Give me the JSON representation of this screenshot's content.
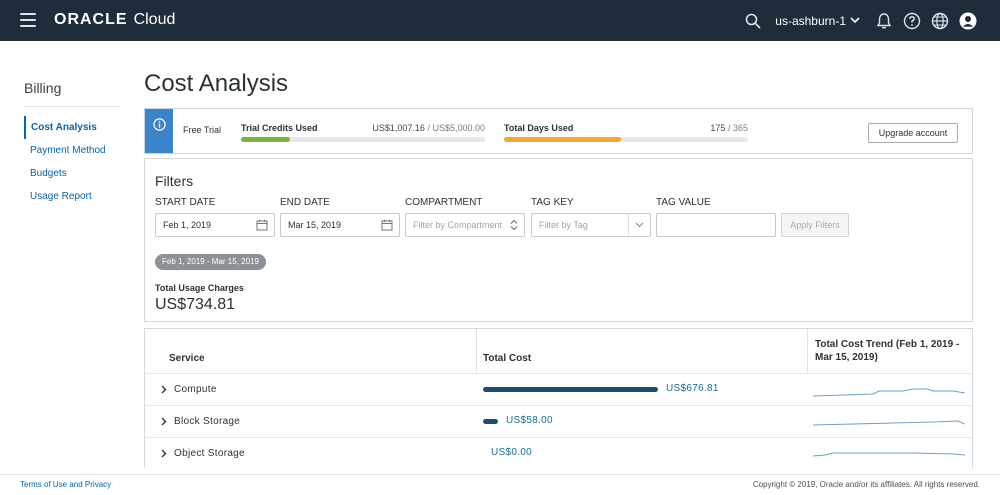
{
  "header": {
    "brand_oracle": "ORACLE",
    "brand_cloud": "Cloud",
    "region": "us-ashburn-1"
  },
  "sidebar": {
    "title": "Billing",
    "items": [
      {
        "label": "Cost Analysis",
        "active": true
      },
      {
        "label": "Payment Method"
      },
      {
        "label": "Budgets"
      },
      {
        "label": "Usage Report"
      }
    ]
  },
  "page": {
    "title": "Cost Analysis"
  },
  "trial": {
    "label": "Free Trial",
    "credits": {
      "title": "Trial Credits Used",
      "used": "US$1,007.16",
      "separator": " / ",
      "total": "US$5,000.00",
      "fraction": 0.2
    },
    "days": {
      "title": "Total Days Used",
      "used": "175",
      "separator": " / ",
      "total": "365",
      "fraction": 0.479
    },
    "upgrade_label": "Upgrade account"
  },
  "filters": {
    "title": "Filters",
    "start_date": {
      "label": "START DATE",
      "value": "Feb 1, 2019"
    },
    "end_date": {
      "label": "END DATE",
      "value": "Mar 15, 2019"
    },
    "compartment": {
      "label": "COMPARTMENT",
      "placeholder": "Filter by Compartment"
    },
    "tag_key": {
      "label": "TAG KEY",
      "placeholder": "Filter by Tag"
    },
    "tag_value": {
      "label": "TAG VALUE",
      "value": ""
    },
    "apply_label": "Apply Filters",
    "range_pill": "Feb 1, 2019 - Mar 15, 2019",
    "total_label": "Total Usage Charges",
    "total_value": "US$734.81"
  },
  "table": {
    "headers": {
      "service": "Service",
      "total_cost": "Total Cost",
      "trend_line1": "Total Cost Trend (Feb 1, 2019 -",
      "trend_line2": "Mar 15, 2019)"
    },
    "rows": [
      {
        "service": "Compute",
        "cost": "US$676.81",
        "fraction": 0.921
      },
      {
        "service": "Block Storage",
        "cost": "US$58.00",
        "fraction": 0.079
      },
      {
        "service": "Object Storage",
        "cost": "US$0.00",
        "fraction": 0
      }
    ]
  },
  "footer": {
    "terms": "Terms of Use and Privacy",
    "copyright": "Copyright © 2019, Oracle and/or its affiliates. All rights reserved."
  },
  "colors": {
    "header_bg": "#1f2d3a",
    "accent_blue": "#0a62a8",
    "credits_fill": "#7cb342",
    "days_fill": "#f0a830",
    "cost_bar": "#1f4e6b"
  }
}
